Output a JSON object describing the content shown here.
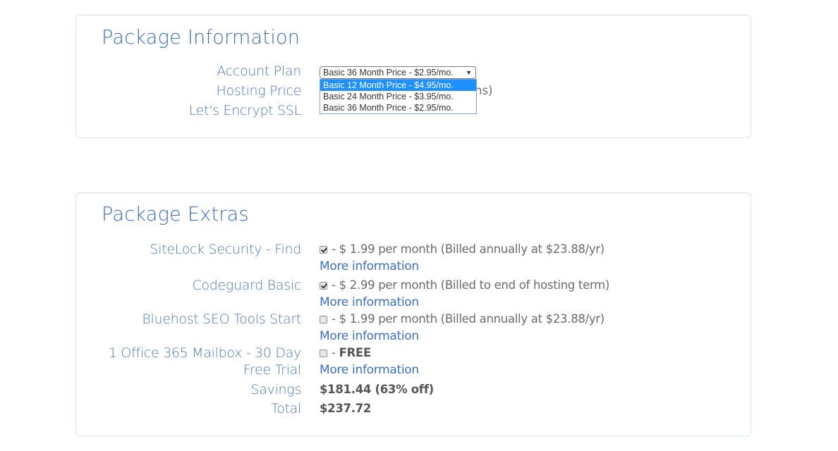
{
  "package_information": {
    "title": "Package Information",
    "labels": {
      "account_plan": "Account Plan",
      "hosting_price": "Hosting Price",
      "ssl": "Let's Encrypt SSL"
    },
    "account_plan_select": {
      "selected": "Basic 36 Month Price - $2.95/mo.",
      "options": [
        "Basic 12 Month Price - $4.95/mo.",
        "Basic 24 Month Price - $3.95/mo.",
        "Basic 36 Month Price - $2.95/mo."
      ],
      "highlighted_option": "Basic 12 Month Price - $4.95/mo."
    },
    "hosting_price_partial": "hs)"
  },
  "package_extras": {
    "title": "Package Extras",
    "items": [
      {
        "label": "SiteLock Security - Find",
        "checked": true,
        "price_text": "- $ 1.99 per month (Billed annually at $23.88/yr)",
        "link": "More information"
      },
      {
        "label": "Codeguard Basic",
        "checked": true,
        "price_text": "- $ 2.99 per month (Billed to end of hosting term)",
        "link": "More information"
      },
      {
        "label": "Bluehost SEO Tools Start",
        "checked": false,
        "price_text": "- $ 1.99 per month (Billed annually at $23.88/yr)",
        "link": "More information"
      },
      {
        "label_line1": "1 Office 365 Mailbox - 30 Day",
        "label_line2": "Free Trial",
        "checked": false,
        "price_prefix": "- ",
        "price_bold": "FREE",
        "link": "More information"
      }
    ],
    "savings_label": "Savings",
    "savings_value": "$181.44 (63% off)",
    "total_label": "Total",
    "total_value": "$237.72"
  },
  "colors": {
    "heading_blue": "#3d6fc0",
    "label_blue": "#4a7ab8",
    "border": "#d6e8f0",
    "highlight": "#1e90ff"
  }
}
